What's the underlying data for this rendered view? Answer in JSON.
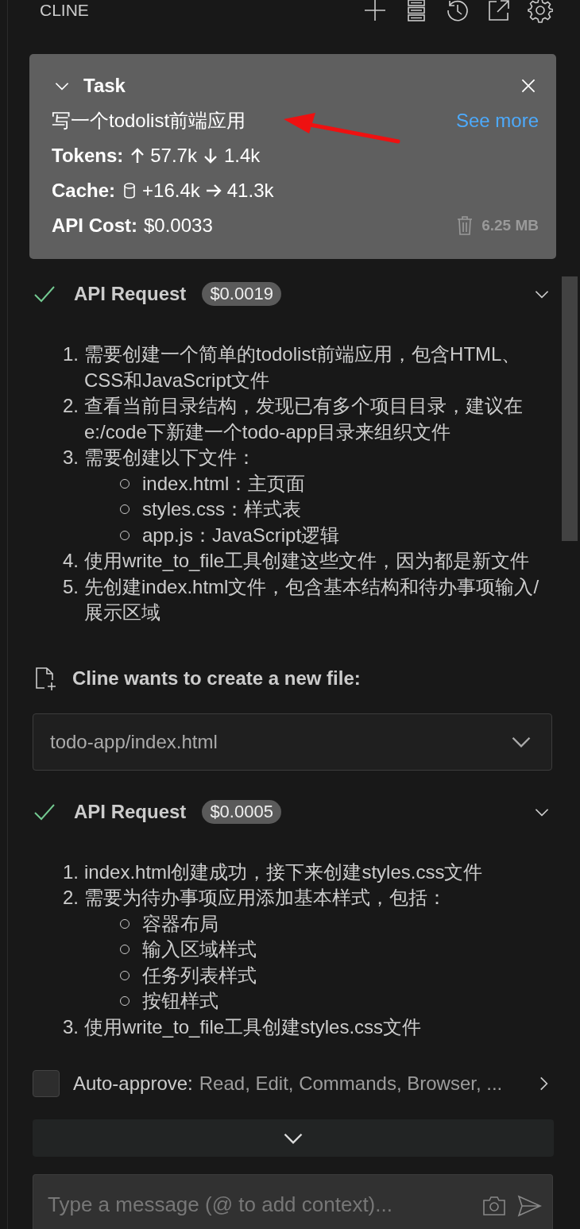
{
  "header": {
    "title": "CLINE"
  },
  "task": {
    "label": "Task",
    "expanded": true,
    "text": "写一个todolist前端应用",
    "see_more": "See more",
    "tokens": {
      "label": "Tokens:",
      "up": "57.7k",
      "down": "1.4k"
    },
    "cache": {
      "label": "Cache:",
      "write": "+16.4k",
      "read": "41.3k"
    },
    "api_cost": {
      "label": "API Cost:",
      "value": "$0.0033"
    },
    "size": "6.25 MB"
  },
  "messages": [
    {
      "kind": "api_request",
      "title": "API Request",
      "cost": "$0.0019",
      "done": true,
      "items": [
        {
          "number": "1.",
          "text": "需要创建一个简单的todolist前端应用，包含HTML、CSS和JavaScript文件"
        },
        {
          "number": "2.",
          "text": "查看当前目录结构，发现已有多个项目目录，建议在e:/code下新建一个todo-app目录来组织文件"
        },
        {
          "number": "3.",
          "text": "需要创建以下文件：",
          "children": [
            {
              "text": "index.html：主页面"
            },
            {
              "text": "styles.css：样式表"
            },
            {
              "text": "app.js：JavaScript逻辑"
            }
          ]
        },
        {
          "number": "4.",
          "text": "使用write_to_file工具创建这些文件，因为都是新文件"
        },
        {
          "number": "5.",
          "text": "先创建index.html文件，包含基本结构和待办事项输入/展示区域"
        }
      ]
    },
    {
      "kind": "tool",
      "title": "Cline wants to create a new file:",
      "path": "todo-app/index.html"
    },
    {
      "kind": "api_request",
      "title": "API Request",
      "cost": "$0.0005",
      "done": true,
      "items": [
        {
          "number": "1.",
          "text": "index.html创建成功，接下来创建styles.css文件"
        },
        {
          "number": "2.",
          "text": "需要为待办事项应用添加基本样式，包括：",
          "children": [
            {
              "text": "容器布局"
            },
            {
              "text": "输入区域样式"
            },
            {
              "text": "任务列表样式"
            },
            {
              "text": "按钮样式"
            }
          ]
        },
        {
          "number": "3.",
          "text": "使用write_to_file工具创建styles.css文件"
        }
      ]
    }
  ],
  "auto_approve": {
    "checked": false,
    "label": "Auto-approve:",
    "value": "Read, Edit, Commands, Browser, ..."
  },
  "input": {
    "placeholder": "Type a message (@ to add context)..."
  }
}
